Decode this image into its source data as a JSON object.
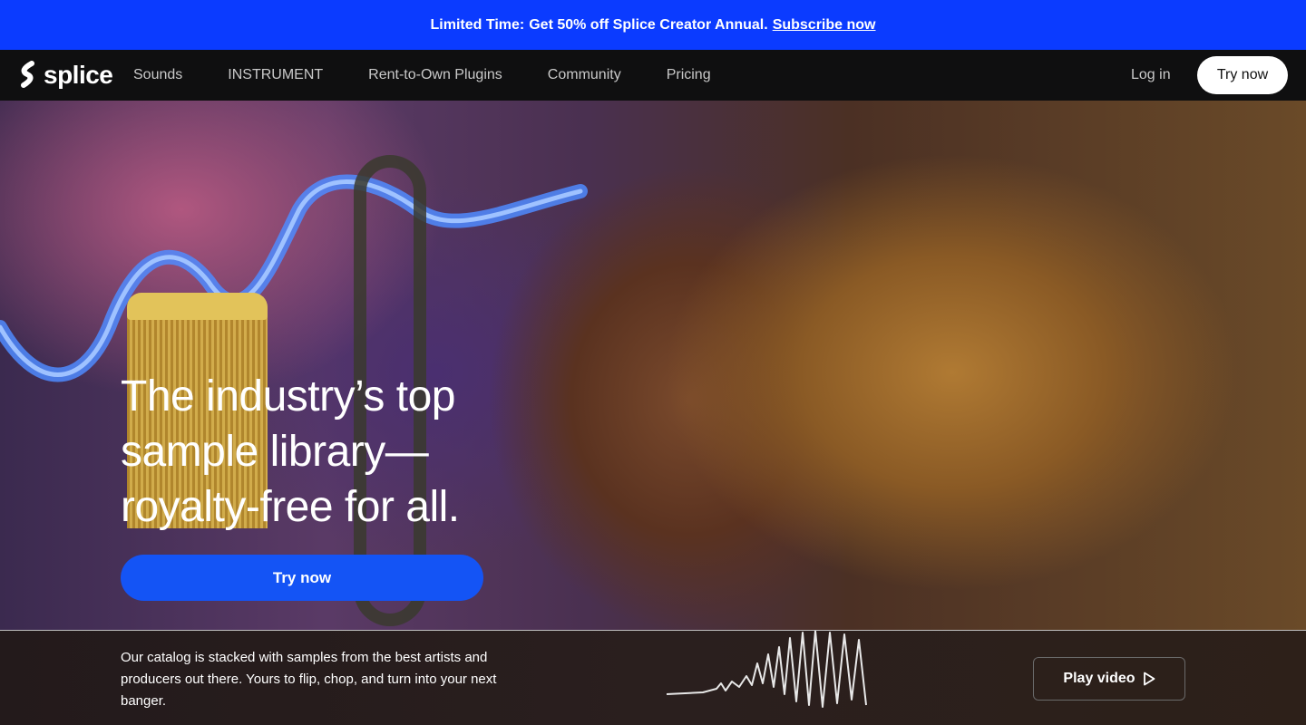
{
  "promo": {
    "lead": "Limited Time:",
    "deal": "Get 50% off Splice Creator Annual.",
    "link": "Subscribe now",
    "bg": "#0b3bff"
  },
  "nav": {
    "logo": "splice",
    "items": [
      {
        "label": "Sounds"
      },
      {
        "label": "INSTRUMENT"
      },
      {
        "label": "Rent-to-Own Plugins"
      },
      {
        "label": "Community"
      },
      {
        "label": "Pricing"
      }
    ],
    "login": "Log in",
    "try_now": "Try now"
  },
  "hero": {
    "headline_lines": [
      "The industry’s top",
      "sample library—",
      "royalty-free for all."
    ],
    "cta": "Try now",
    "cta_color": "#1454f5"
  },
  "bottom": {
    "description": "Our catalog is stacked with samples from the best artists and producers out there. Yours to flip, chop, and turn into your next banger.",
    "play_video": "Play video"
  },
  "icons": [
    "splice-logo-icon",
    "waveform-icon",
    "play-icon"
  ]
}
